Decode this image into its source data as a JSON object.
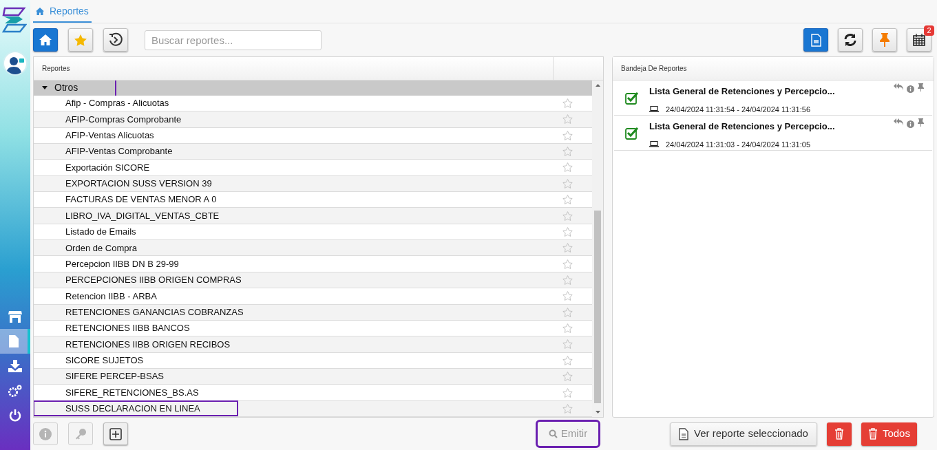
{
  "breadcrumb": {
    "label": "Reportes"
  },
  "sidebar": {
    "items": [
      {
        "kind": "store",
        "selected": false
      },
      {
        "kind": "document",
        "selected": true
      },
      {
        "kind": "download",
        "selected": false
      },
      {
        "kind": "settings",
        "selected": false
      },
      {
        "kind": "power",
        "selected": false
      }
    ]
  },
  "toolbar": {
    "left_buttons": [
      {
        "kind": "home",
        "selected": true
      },
      {
        "kind": "favorites",
        "selected": false
      },
      {
        "kind": "history",
        "selected": false
      }
    ],
    "search": {
      "placeholder": "Buscar reportes..."
    },
    "right_buttons": [
      {
        "kind": "document",
        "selected": true
      },
      {
        "kind": "refresh",
        "selected": false
      },
      {
        "kind": "pin",
        "selected": false
      },
      {
        "kind": "calendar",
        "selected": false,
        "badge": "2"
      }
    ]
  },
  "reports": {
    "header": "Reportes",
    "group": {
      "label": "Otros",
      "expanded": true,
      "highlighted": true
    },
    "rows": [
      {
        "label": "Afip - Compras - Alicuotas",
        "favorite": false,
        "highlighted": false
      },
      {
        "label": "AFIP-Compras Comprobante",
        "favorite": false,
        "highlighted": false
      },
      {
        "label": "AFIP-Ventas Alicuotas",
        "favorite": false,
        "highlighted": false
      },
      {
        "label": "AFIP-Ventas Comprobante",
        "favorite": false,
        "highlighted": false
      },
      {
        "label": "Exportación SICORE",
        "favorite": false,
        "highlighted": false
      },
      {
        "label": "EXPORTACION SUSS VERSION 39",
        "favorite": false,
        "highlighted": false
      },
      {
        "label": "FACTURAS DE VENTAS MENOR A 0",
        "favorite": false,
        "highlighted": false
      },
      {
        "label": "LIBRO_IVA_DIGITAL_VENTAS_CBTE",
        "favorite": false,
        "highlighted": false
      },
      {
        "label": "Listado de Emails",
        "favorite": false,
        "highlighted": false
      },
      {
        "label": "Orden de Compra",
        "favorite": false,
        "highlighted": false
      },
      {
        "label": "Percepcion IIBB DN B 29-99",
        "favorite": false,
        "highlighted": false
      },
      {
        "label": "PERCEPCIONES IIBB ORIGEN COMPRAS",
        "favorite": false,
        "highlighted": false
      },
      {
        "label": "Retencion IIBB - ARBA",
        "favorite": false,
        "highlighted": false
      },
      {
        "label": "RETENCIONES GANANCIAS COBRANZAS",
        "favorite": false,
        "highlighted": false
      },
      {
        "label": "RETENCIONES IIBB BANCOS",
        "favorite": false,
        "highlighted": false
      },
      {
        "label": "RETENCIONES IIBB ORIGEN RECIBOS",
        "favorite": false,
        "highlighted": false
      },
      {
        "label": "SICORE SUJETOS",
        "favorite": false,
        "highlighted": false
      },
      {
        "label": "SIFERE PERCEP-BSAS",
        "favorite": false,
        "highlighted": false
      },
      {
        "label": "SIFERE_RETENCIONES_BS.AS",
        "favorite": false,
        "highlighted": false
      },
      {
        "label": "SUSS DECLARACION EN LINEA",
        "favorite": false,
        "highlighted": true
      }
    ]
  },
  "tray": {
    "header": "Bandeja De Reportes",
    "items": [
      {
        "title": "Lista General de Retenciones y Percepcio...",
        "time": "24/04/2024 11:31:54 - 24/04/2024 11:31:56",
        "done": true
      },
      {
        "title": "Lista General de Retenciones y Percepcio...",
        "time": "24/04/2024 11:31:03 - 24/04/2024 11:31:05",
        "done": true
      }
    ]
  },
  "bottom": {
    "emit": {
      "label": "Emitir",
      "disabled": true,
      "highlighted": true
    },
    "view": {
      "label": "Ver reporte seleccionado"
    },
    "delete_all": {
      "label": "Todos"
    }
  }
}
